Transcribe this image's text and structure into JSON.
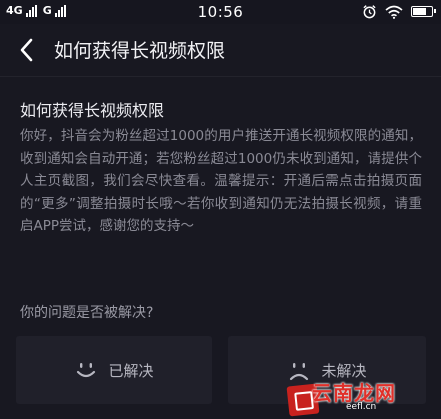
{
  "status_bar": {
    "network_1": "4G",
    "network_2": "G",
    "time": "10:56",
    "icons": [
      "signal-bars-icon",
      "alarm-icon",
      "wifi-icon",
      "battery-icon"
    ],
    "battery_level": 0.8
  },
  "navbar": {
    "back_icon": "chevron-left-icon",
    "title": "如何获得长视频权限"
  },
  "article": {
    "title": "如何获得长视频权限",
    "body": "你好，抖音会为粉丝超过1000的用户推送开通长视频权限的通知，收到通知会自动开通；若您粉丝超过1000仍未收到通知，请提供个人主页截图，我们会尽快查看。温馨提示：开通后需点击拍摄页面的“更多”调整拍摄时长哦～若你收到通知仍无法拍摄长视频，请重启APP尝试，感谢您的支持～"
  },
  "feedback": {
    "question": "你的问题是否被解决?",
    "resolved_label": "已解决",
    "unresolved_label": "未解决",
    "resolved_icon": "smile-face-icon",
    "unresolved_icon": "frown-face-icon"
  },
  "watermark": {
    "text": "云南龙网",
    "url": "eefl.cn"
  },
  "colors": {
    "background": "#181821",
    "button_bg": "#20202a",
    "body_text": "#8a8a95",
    "watermark_red": "#e0302a"
  }
}
